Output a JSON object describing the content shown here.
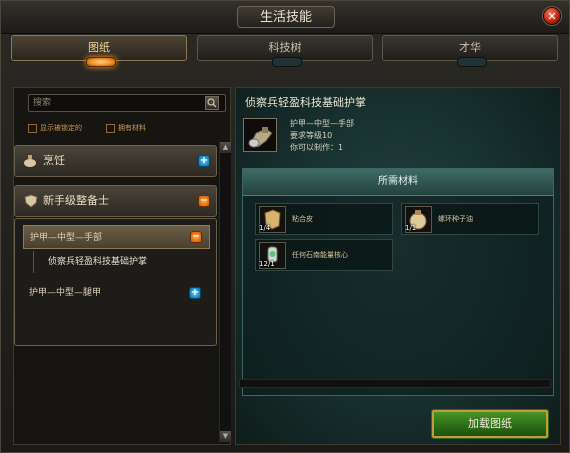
{
  "window": {
    "title": "生活技能"
  },
  "tabs": [
    {
      "label": "图纸",
      "active": true
    },
    {
      "label": "科技树",
      "active": false
    },
    {
      "label": "才华",
      "active": false
    }
  ],
  "left": {
    "search_placeholder": "搜索",
    "filters": [
      "显示被锁定的",
      "拥有材料"
    ],
    "categories": [
      {
        "label": "烹饪",
        "expanded": false
      },
      {
        "label": "新手级整备士",
        "expanded": true
      }
    ],
    "subcategories": [
      {
        "label": "护甲—中型—手部",
        "expanded": true
      },
      {
        "label": "护甲—中型—腿甲",
        "expanded": false
      }
    ],
    "recipes": [
      "侦察兵轻盈科技基础护掌"
    ]
  },
  "detail": {
    "title": "侦察兵轻盈科技基础护掌",
    "type": "护甲—中型—手部",
    "req_level": "要求等级10",
    "can_make": "你可以制作：1",
    "materials_header": "所需材料",
    "materials": [
      {
        "name": "粘合皮",
        "count": "1/4",
        "icon": "leather-icon"
      },
      {
        "name": "螺环种子油",
        "count": "1/1",
        "icon": "oil-icon"
      },
      {
        "name": "任何石南能量核心",
        "count": "12/1",
        "icon": "energy-core-icon"
      }
    ],
    "load_button": "加载图纸"
  },
  "colors": {
    "accent": "#f08a1c",
    "teal": "#24423f",
    "green_button": "#2c6d16"
  }
}
